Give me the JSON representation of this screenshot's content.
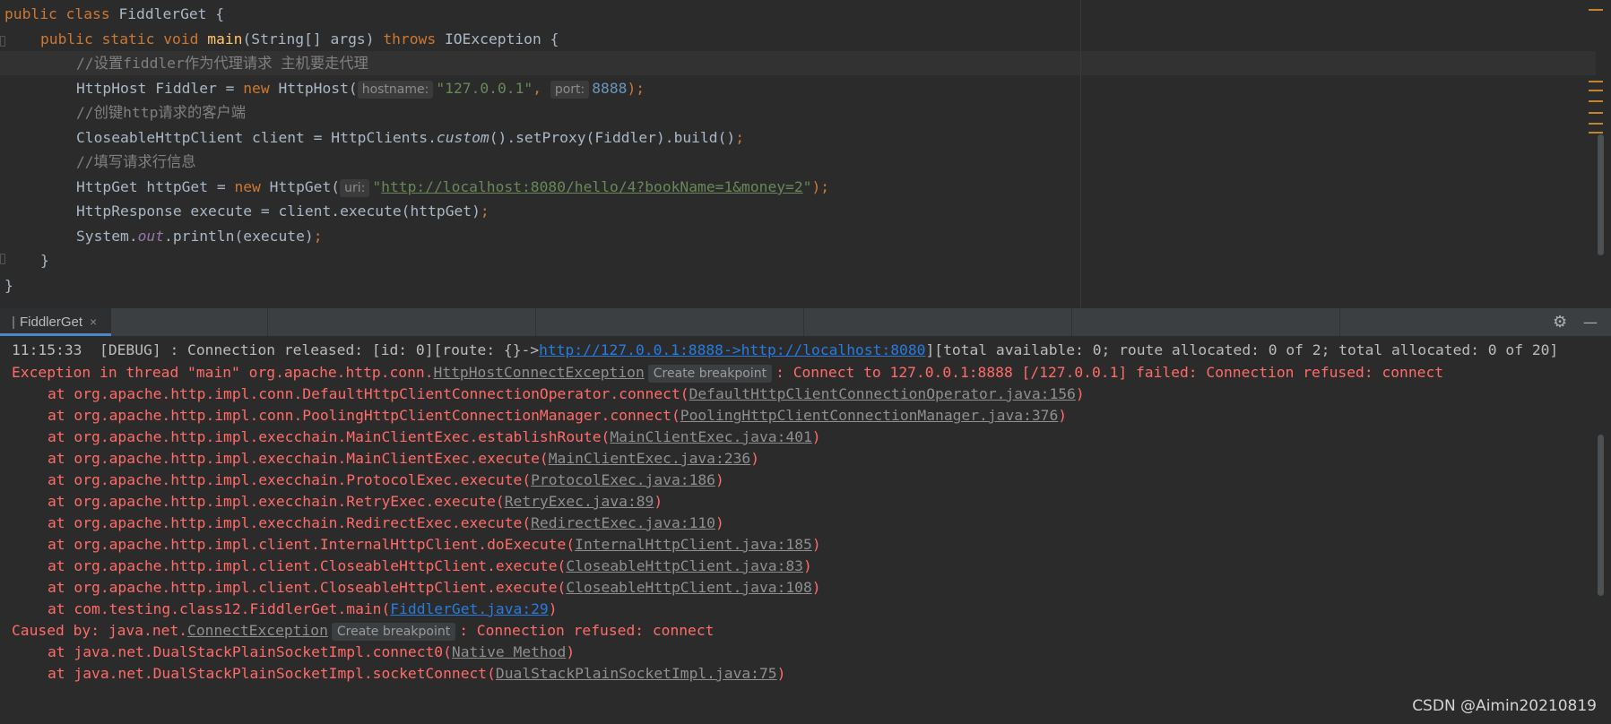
{
  "editor": {
    "lines": {
      "l1": {
        "kw1": "public ",
        "kw2": "class ",
        "name": "FiddlerGet {"
      },
      "l2": {
        "kw1": "public ",
        "kw2": "static ",
        "kw3": "void ",
        "fn": "main",
        "sig": "(String[] args) ",
        "kw4": "throws ",
        "rest": "IOException {"
      },
      "l3": {
        "comment": "//设置fiddler作为代理请求 主机要走代理"
      },
      "l4": {
        "a": "HttpHost Fiddler = ",
        "kw": "new ",
        "b": "HttpHost(",
        "hint1": "hostname:",
        "str": "\"127.0.0.1\"",
        "comma": ",",
        "hint2": "port:",
        "num": "8888",
        "end": ");"
      },
      "l5": {
        "comment": "//创键http请求的客户端"
      },
      "l6": {
        "a": "CloseableHttpClient client = HttpClients.",
        "it": "custom",
        "b": "().setProxy(Fiddler).build()",
        "end": ";"
      },
      "l7": {
        "comment": "//填写请求行信息"
      },
      "l8": {
        "a": "HttpGet httpGet = ",
        "kw": "new ",
        "b": "HttpGet(",
        "hint": "uri:",
        "q1": "\"",
        "url": "http://localhost:8080/hello/4?bookName=1&money=2",
        "q2": "\"",
        "end": ");"
      },
      "l9": {
        "a": "HttpResponse execute = client.execute(httpGet)",
        "end": ";"
      },
      "l10": {
        "a": "System.",
        "field": "out",
        "b": ".println(execute)",
        "end": ";"
      },
      "l11": {
        "text": "}"
      },
      "l12": {
        "text": "}"
      }
    }
  },
  "run_panel": {
    "tab_label": "FiddlerGet",
    "close_glyph": "×",
    "settings_glyph": "⚙",
    "minimize_glyph": "—"
  },
  "console": {
    "debug": {
      "prefix": "11:15:33  [DEBUG] : Connection released: [id: 0][route: {}->",
      "link1": "http://127.0.0.1:8888",
      "arrow": "->",
      "link2": "http://localhost:8080",
      "suffix": "][total available: 0; route allocated: 0 of 2; total allocated: 0 of 20]"
    },
    "exception": {
      "prefix": "Exception in thread \"main\" org.apache.http.conn.",
      "cls": "HttpHostConnectException",
      "badge": "Create breakpoint",
      "msg": ": Connect to 127.0.0.1:8888 [/127.0.0.1] failed: Connection refused: connect"
    },
    "stack": [
      {
        "method": "at org.apache.http.impl.conn.DefaultHttpClientConnectionOperator.connect(",
        "loc": "DefaultHttpClientConnectionOperator.java:156",
        "end": ")"
      },
      {
        "method": "at org.apache.http.impl.conn.PoolingHttpClientConnectionManager.connect(",
        "loc": "PoolingHttpClientConnectionManager.java:376",
        "end": ")"
      },
      {
        "method": "at org.apache.http.impl.execchain.MainClientExec.establishRoute(",
        "loc": "MainClientExec.java:401",
        "end": ")"
      },
      {
        "method": "at org.apache.http.impl.execchain.MainClientExec.execute(",
        "loc": "MainClientExec.java:236",
        "end": ")"
      },
      {
        "method": "at org.apache.http.impl.execchain.ProtocolExec.execute(",
        "loc": "ProtocolExec.java:186",
        "end": ")"
      },
      {
        "method": "at org.apache.http.impl.execchain.RetryExec.execute(",
        "loc": "RetryExec.java:89",
        "end": ")"
      },
      {
        "method": "at org.apache.http.impl.execchain.RedirectExec.execute(",
        "loc": "RedirectExec.java:110",
        "end": ")"
      },
      {
        "method": "at org.apache.http.impl.client.InternalHttpClient.doExecute(",
        "loc": "InternalHttpClient.java:185",
        "end": ")"
      },
      {
        "method": "at org.apache.http.impl.client.CloseableHttpClient.execute(",
        "loc": "CloseableHttpClient.java:83",
        "end": ")"
      },
      {
        "method": "at org.apache.http.impl.client.CloseableHttpClient.execute(",
        "loc": "CloseableHttpClient.java:108",
        "end": ")"
      },
      {
        "method": "at com.testing.class12.FiddlerGet.main(",
        "loc": "FiddlerGet.java:29",
        "end": ")"
      }
    ],
    "caused": {
      "prefix": "Caused by: java.net.",
      "cls": "ConnectException",
      "badge": "Create breakpoint",
      "msg": ": Connection refused: connect"
    },
    "stack2": [
      {
        "method": "at java.net.DualStackPlainSocketImpl.connect0(",
        "loc": "Native Method",
        "end": ")"
      },
      {
        "method": "at java.net.DualStackPlainSocketImpl.socketConnect(",
        "loc": "DualStackPlainSocketImpl.java:75",
        "end": ")"
      }
    ]
  },
  "watermark": "CSDN @Aimin20210819",
  "colors": {
    "keyword": "#cc7832",
    "string": "#6a8759",
    "error": "#ff6b68",
    "link": "#287bde"
  }
}
